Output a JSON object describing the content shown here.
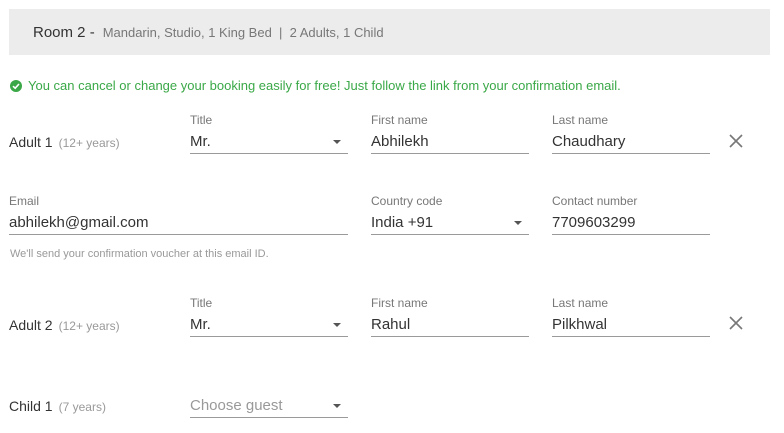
{
  "room": {
    "title": "Room 2 -",
    "details": "Mandarin, Studio, 1 King Bed  |  2 Adults, 1 Child"
  },
  "notice": "You can cancel or change your booking easily for free! Just follow the link from your confirmation email.",
  "adult1": {
    "label": "Adult 1",
    "age": "(12+ years)",
    "title_label": "Title",
    "title_value": "Mr.",
    "first_label": "First name",
    "first_value": "Abhilekh",
    "last_label": "Last name",
    "last_value": "Chaudhary",
    "email_label": "Email",
    "email_value": "abhilekh@gmail.com",
    "email_help": "We'll send your confirmation voucher at this email ID.",
    "country_label": "Country code",
    "country_value": "India +91",
    "contact_label": "Contact number",
    "contact_value": "7709603299"
  },
  "adult2": {
    "label": "Adult 2",
    "age": "(12+ years)",
    "title_label": "Title",
    "title_value": "Mr.",
    "first_label": "First name",
    "first_value": "Rahul",
    "last_label": "Last name",
    "last_value": "Pilkhwal"
  },
  "child1": {
    "label": "Child 1",
    "age": "(7 years)",
    "guest_placeholder": "Choose guest"
  },
  "icons": {
    "notice": "check-circle-icon",
    "remove": "close-icon",
    "dropdown": "caret-down-icon"
  },
  "colors": {
    "success": "#3aa847",
    "header_bg": "#ececec"
  }
}
